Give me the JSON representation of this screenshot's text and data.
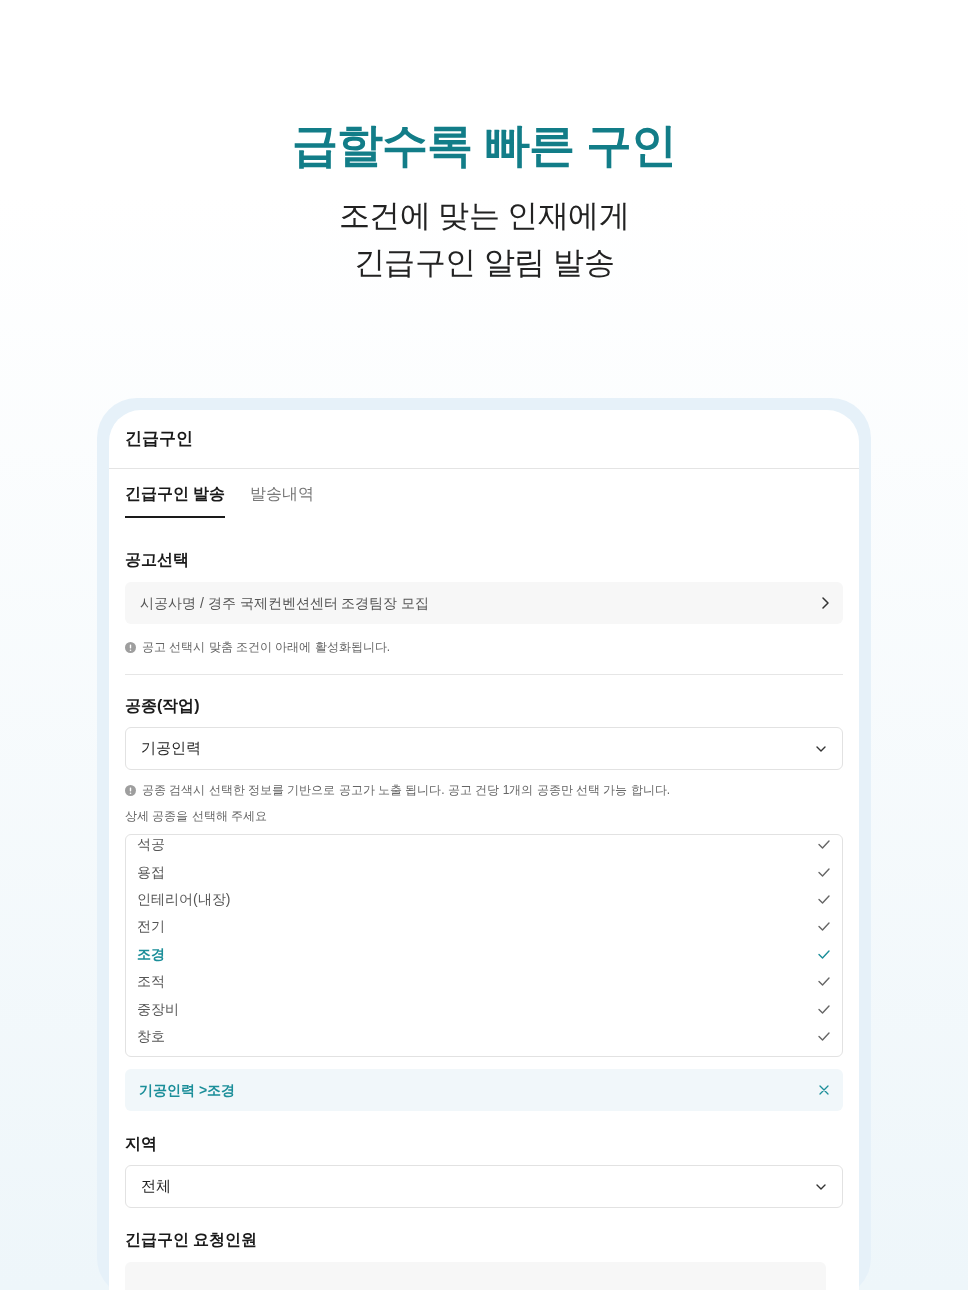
{
  "hero": {
    "title": "급할수록 빠른 구인",
    "subtitle_lines": [
      "조건에 맞는 인재에게",
      "긴급구인 알림 발송"
    ]
  },
  "panel": {
    "title": "긴급구인",
    "tabs": [
      {
        "label": "긴급구인 발송",
        "selected": true
      },
      {
        "label": "발송내역",
        "selected": false
      }
    ]
  },
  "posting": {
    "label": "공고선택",
    "value": "시공사명 / 경주 국제컨벤션센터 조경팀장 모집",
    "note": "공고 선택시 맞춤 조건이 아래에 활성화됩니다."
  },
  "trade": {
    "label": "공종(작업)",
    "value": "기공인력",
    "note": "공종 검색시 선택한 정보를 기반으로 공고가 노출 됩니다. 공고 건당 1개의 공종만 선택 가능 합니다.",
    "sub_label": "상세 공종을 선택해 주세요",
    "options": [
      {
        "label": "석공",
        "selected": false
      },
      {
        "label": "용접",
        "selected": false
      },
      {
        "label": "인테리어(내장)",
        "selected": false
      },
      {
        "label": "전기",
        "selected": false
      },
      {
        "label": "조경",
        "selected": true
      },
      {
        "label": "조적",
        "selected": false
      },
      {
        "label": "중장비",
        "selected": false
      },
      {
        "label": "창호",
        "selected": false
      }
    ],
    "chosen": [
      {
        "label": "기공인력 >조경"
      }
    ]
  },
  "region": {
    "label": "지역",
    "value": "전체"
  },
  "headcount": {
    "label": "긴급구인 요청인원"
  }
}
